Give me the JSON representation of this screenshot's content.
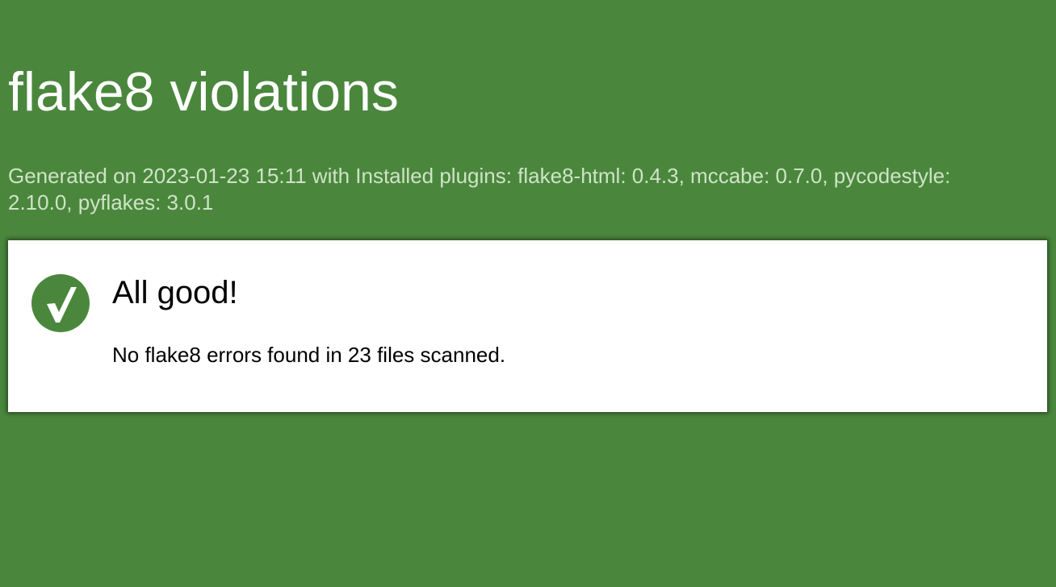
{
  "header": {
    "title": "flake8 violations",
    "subtitle": "Generated on 2023-01-23 15:11 with Installed plugins: flake8-html: 0.4.3, mccabe: 0.7.0, pycodestyle: 2.10.0, pyflakes: 3.0.1"
  },
  "result": {
    "icon": "check-icon",
    "heading": "All good!",
    "message": "No flake8 errors found in 23 files scanned."
  },
  "colors": {
    "background": "#4a873d",
    "subtitle": "#cfe3c6",
    "card": "#ffffff"
  }
}
